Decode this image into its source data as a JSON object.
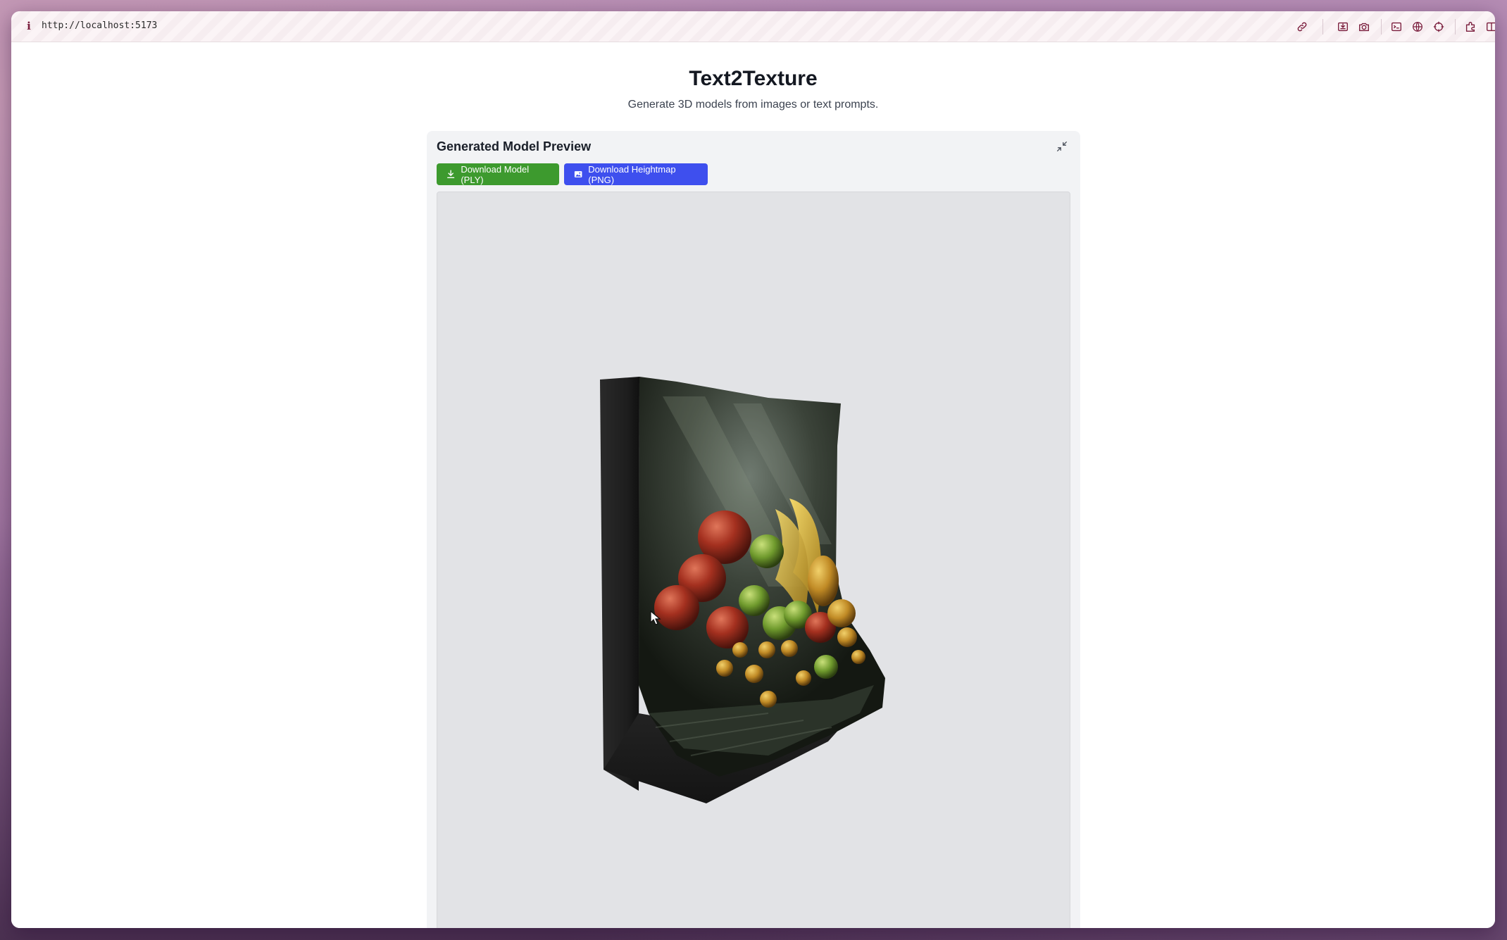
{
  "browser": {
    "url": "http://localhost:5173",
    "info_icon": "i",
    "toolbar_icons": [
      "link-icon",
      "save-page-icon",
      "camera-icon",
      "terminal-icon",
      "globe-icon",
      "crosshair-icon",
      "extension-icon",
      "sidebar-icon"
    ]
  },
  "page": {
    "title": "Text2Texture",
    "subtitle": "Generate 3D models from images or text prompts."
  },
  "preview": {
    "title": "Generated Model Preview",
    "collapse_icon": "collapse-icon",
    "download_model_label": "Download Model (PLY)",
    "download_heightmap_label": "Download Heightmap (PNG)",
    "download_model_icon": "download-icon",
    "download_heightmap_icon": "image-icon",
    "download_model_color": "#3d9a2e",
    "download_heightmap_color": "#3e4fee"
  },
  "viewer": {
    "background": "#e2e3e6",
    "model_subject": "fruit-still-life-relief"
  }
}
